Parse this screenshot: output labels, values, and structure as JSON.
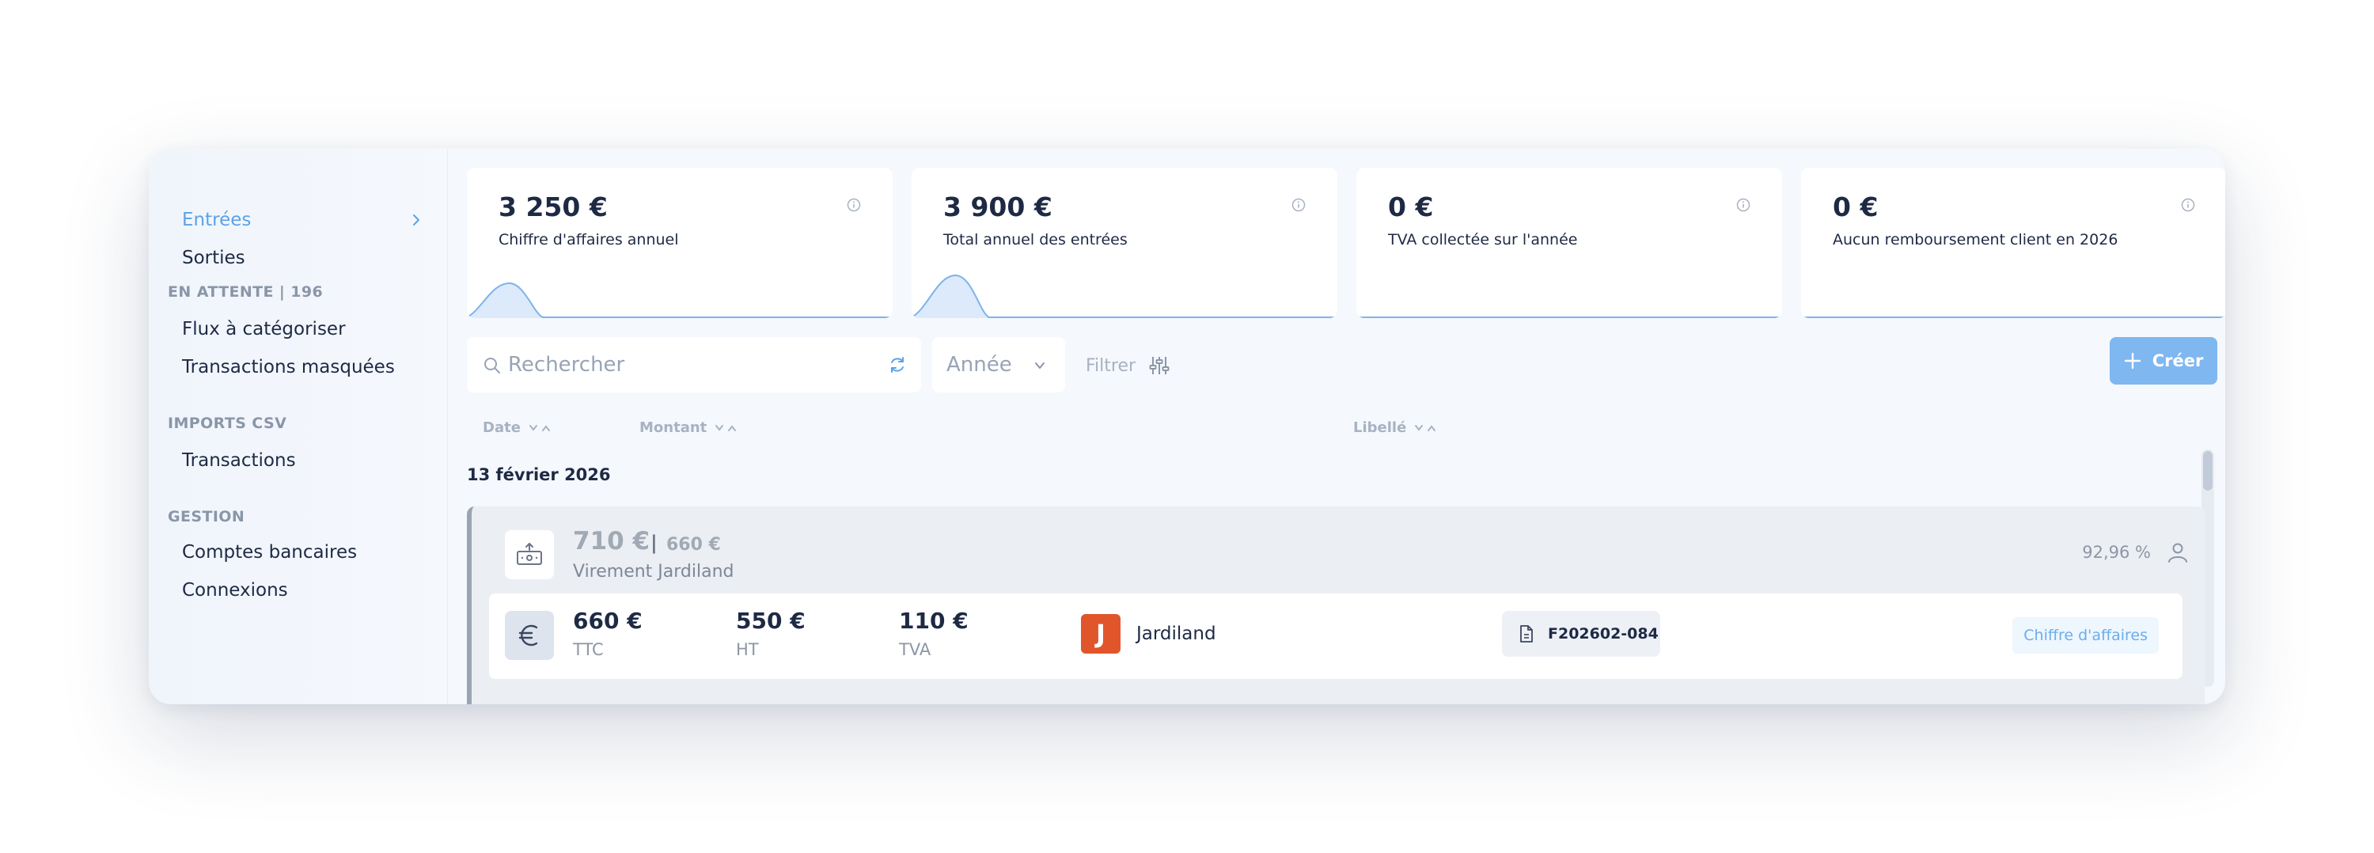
{
  "sidebar": {
    "items": [
      {
        "label": "Entrées",
        "active": true
      },
      {
        "label": "Sorties"
      },
      {
        "label": "Flux à catégoriser"
      },
      {
        "label": "Transactions masquées"
      },
      {
        "label": "Transactions"
      },
      {
        "label": "Comptes bancaires"
      },
      {
        "label": "Connexions"
      }
    ],
    "sections": {
      "pending": "EN ATTENTE | 196",
      "imports": "IMPORTS CSV",
      "gestion": "GESTION"
    }
  },
  "cards": [
    {
      "amount": "3 250 €",
      "label": "Chiffre d'affaires annuel"
    },
    {
      "amount": "3 900 €",
      "label": "Total annuel des entrées"
    },
    {
      "amount": "0 €",
      "label": "TVA collectée sur l'année"
    },
    {
      "amount": "0 €",
      "label": "Aucun remboursement client en 2026"
    }
  ],
  "toolbar": {
    "search_placeholder": "Rechercher",
    "year_label": "Année",
    "filter_label": "Filtrer",
    "create_label": "Créer"
  },
  "columns": {
    "date": "Date",
    "amount": "Montant",
    "label": "Libellé"
  },
  "list": {
    "date_header": "13 février 2026",
    "transaction": {
      "amount": "710 €",
      "separator": "|",
      "sub_amount": "660 €",
      "label": "Virement Jardiland",
      "percentage": "92,96 %",
      "detail": {
        "ttc_value": "660 €",
        "ttc_label": "TTC",
        "ht_value": "550 €",
        "ht_label": "HT",
        "tva_value": "110 €",
        "tva_label": "TVA",
        "vendor_initial": "J",
        "vendor_name": "Jardiland",
        "invoice_number": "F202602-084",
        "category": "Chiffre d'affaires"
      }
    }
  },
  "colors": {
    "accent": "#5aa2e8",
    "create_button": "#7fb7f0",
    "vendor_logo": "#e0562a",
    "text_dark": "#1e2a44"
  }
}
